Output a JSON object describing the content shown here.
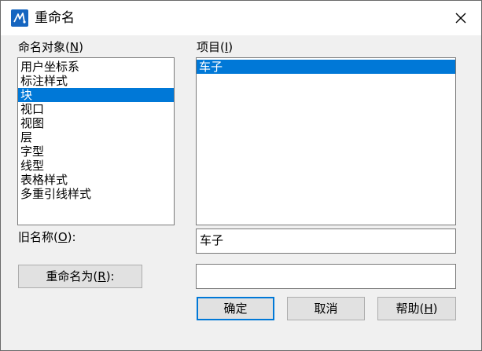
{
  "window": {
    "title": "重命名"
  },
  "objects": {
    "label_text": "命名对象(",
    "label_key": "N",
    "label_tail": ")",
    "items": [
      "用户坐标系",
      "标注样式",
      "块",
      "视口",
      "视图",
      "层",
      "字型",
      "线型",
      "表格样式",
      "多重引线样式"
    ],
    "selected_index": 2
  },
  "items_list": {
    "label_text": "项目(",
    "label_key": "I",
    "label_tail": ")",
    "items": [
      "车子"
    ],
    "selected_index": 0
  },
  "old_name": {
    "label_text": "旧名称(",
    "label_key": "O",
    "label_tail": "):",
    "value": "车子"
  },
  "rename_to": {
    "button_text": "重命名为(",
    "button_key": "R",
    "button_tail": "):",
    "value": ""
  },
  "buttons": {
    "ok": "确定",
    "cancel": "取消",
    "help_text": "帮助(",
    "help_key": "H",
    "help_tail": ")"
  },
  "colors": {
    "selection": "#0078d7",
    "dialog_bg": "#f0f0f0",
    "app_icon": "#1565c0"
  },
  "icons": {
    "app": "app-logo-icon",
    "close": "close-icon"
  }
}
